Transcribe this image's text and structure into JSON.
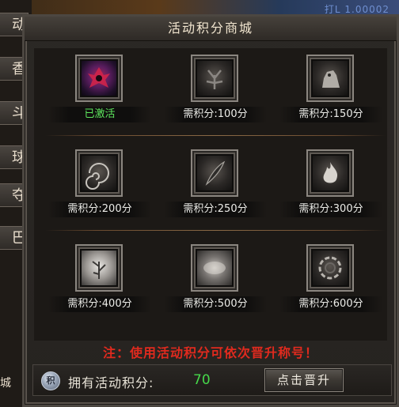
{
  "background": {
    "top_text": "打L    1.00002"
  },
  "left_menu": {
    "tabs": [
      "动",
      "香谷",
      "斗场",
      "球场",
      "夺占",
      "巴克"
    ],
    "bottom_text": "城"
  },
  "panel": {
    "title": "活动积分商城",
    "items": [
      {
        "label": "已激活",
        "icon": "demon-emblem-icon",
        "active": true
      },
      {
        "label": "需积分:100分",
        "icon": "tree-creature-icon",
        "active": false
      },
      {
        "label": "需积分:150分",
        "icon": "stone-beast-icon",
        "active": false
      },
      {
        "label": "需积分:200分",
        "icon": "vortex-icon",
        "active": false
      },
      {
        "label": "需积分:250分",
        "icon": "feather-icon",
        "active": false
      },
      {
        "label": "需积分:300分",
        "icon": "flame-icon",
        "active": false
      },
      {
        "label": "需积分:400分",
        "icon": "rune-plant-icon",
        "active": false
      },
      {
        "label": "需积分:500分",
        "icon": "mist-cloud-icon",
        "active": false
      },
      {
        "label": "需积分:600分",
        "icon": "ring-portal-icon",
        "active": false
      }
    ],
    "notice": "注：使用活动积分可依次晋升称号！",
    "footer": {
      "coin_glyph": "积",
      "points_label": "拥有活动积分:",
      "points_value": "70",
      "promote_button": "点击晋升"
    }
  },
  "colors": {
    "active_label": "#5ee85e",
    "notice": "#e02a1e",
    "points_value": "#46d84a"
  }
}
